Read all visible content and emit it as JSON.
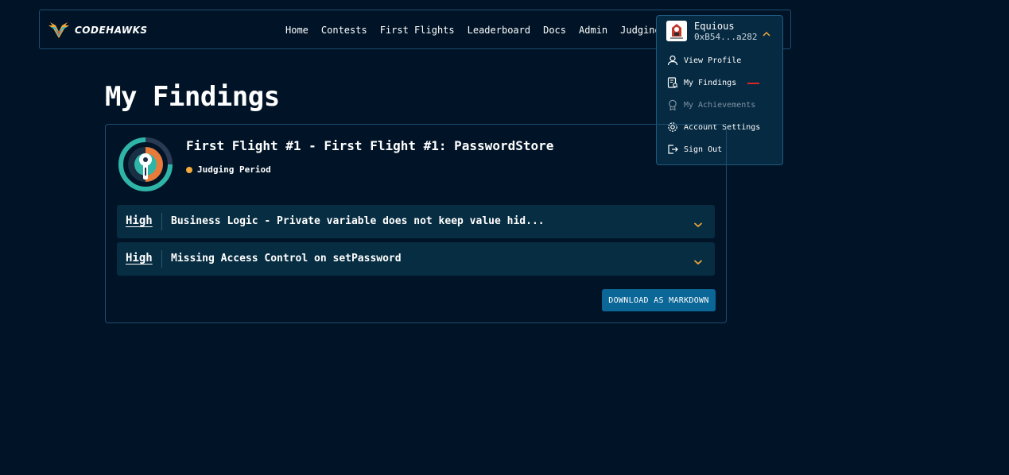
{
  "brand": {
    "name": "CODEHAWKS"
  },
  "nav": {
    "links": [
      "Home",
      "Contests",
      "First Flights",
      "Leaderboard",
      "Docs",
      "Admin",
      "Judging"
    ]
  },
  "user": {
    "name": "Equious",
    "address": "0xB54...a282",
    "menu": [
      {
        "label": "View Profile",
        "icon": "user-icon"
      },
      {
        "label": "My Findings",
        "icon": "findings-icon"
      },
      {
        "label": "My Achievements",
        "icon": "award-icon",
        "disabled": true
      },
      {
        "label": "Account Settings",
        "icon": "gear-icon"
      },
      {
        "label": "Sign Out",
        "icon": "sign-out-icon"
      }
    ]
  },
  "page": {
    "title": "My Findings"
  },
  "contest": {
    "title": "First Flight #1 - First Flight #1: PasswordStore",
    "status": "Judging Period",
    "findings": [
      {
        "severity": "High",
        "title": "Business Logic - Private variable does not keep value hid..."
      },
      {
        "severity": "High",
        "title": "Missing Access Control on setPassword"
      }
    ],
    "download_label": "DOWNLOAD AS MARKDOWN"
  },
  "colors": {
    "background": "#011427",
    "accent": "#f6a93b",
    "button": "#0b6797",
    "finding_row": "#072d42"
  }
}
